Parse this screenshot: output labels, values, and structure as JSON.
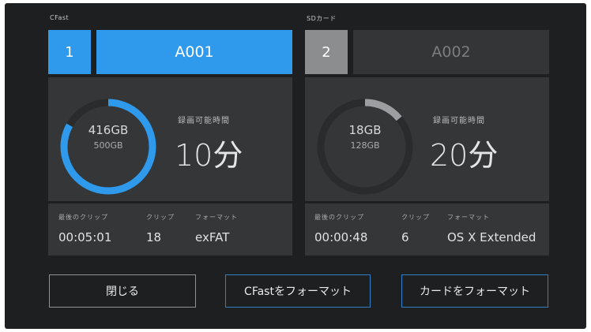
{
  "slots": [
    {
      "media_label": "CFast",
      "slot_number": "1",
      "clip_name": "A001",
      "used": "416GB",
      "total": "500GB",
      "used_fraction": 0.83,
      "remaining_label": "録画可能時間",
      "remaining_value": "10分",
      "last_clip_label": "最後のクリップ",
      "last_clip_value": "00:05:01",
      "clips_label": "クリップ",
      "clips_value": "18",
      "format_label": "フォーマット",
      "format_value": "exFAT",
      "active": true
    },
    {
      "media_label": "SDカード",
      "slot_number": "2",
      "clip_name": "A002",
      "used": "18GB",
      "total": "128GB",
      "used_fraction": 0.14,
      "remaining_label": "録画可能時間",
      "remaining_value": "20分",
      "last_clip_label": "最後のクリップ",
      "last_clip_value": "00:00:48",
      "clips_label": "クリップ",
      "clips_value": "6",
      "format_label": "フォーマット",
      "format_value": "OS X Extended",
      "active": false
    }
  ],
  "buttons": {
    "close_label": "閉じる",
    "format_cfast_label": "CFastをフォーマット",
    "format_card_label": "カードをフォーマット"
  },
  "colors": {
    "accent": "#2f99ec",
    "background": "#1e1f21",
    "panel": "#353638",
    "ring_track": "#2a2b2d",
    "ring_active": "#2f99ec",
    "ring_inactive": "#9c9ea1"
  }
}
